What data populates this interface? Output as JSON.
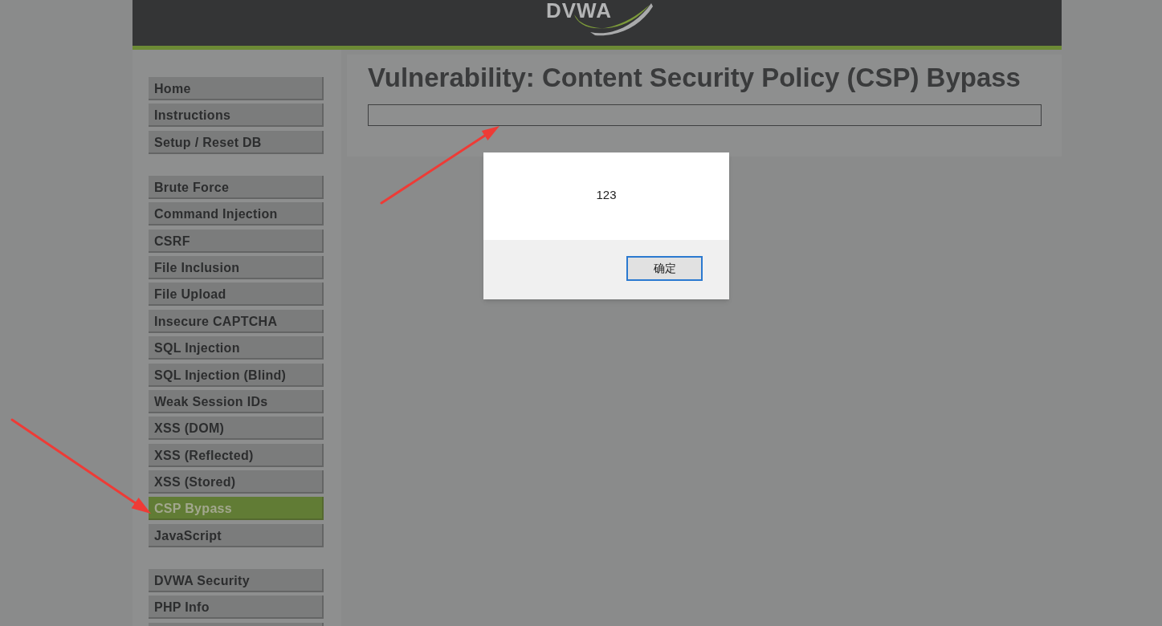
{
  "header": {
    "logo_text": "DVWA"
  },
  "menu": [
    {
      "items": [
        {
          "label": "Home",
          "selected": false
        },
        {
          "label": "Instructions",
          "selected": false
        },
        {
          "label": "Setup / Reset DB",
          "selected": false
        }
      ]
    },
    {
      "items": [
        {
          "label": "Brute Force",
          "selected": false
        },
        {
          "label": "Command Injection",
          "selected": false
        },
        {
          "label": "CSRF",
          "selected": false
        },
        {
          "label": "File Inclusion",
          "selected": false
        },
        {
          "label": "File Upload",
          "selected": false
        },
        {
          "label": "Insecure CAPTCHA",
          "selected": false
        },
        {
          "label": "SQL Injection",
          "selected": false
        },
        {
          "label": "SQL Injection (Blind)",
          "selected": false
        },
        {
          "label": "Weak Session IDs",
          "selected": false
        },
        {
          "label": "XSS (DOM)",
          "selected": false
        },
        {
          "label": "XSS (Reflected)",
          "selected": false
        },
        {
          "label": "XSS (Stored)",
          "selected": false
        },
        {
          "label": "CSP Bypass",
          "selected": true
        },
        {
          "label": "JavaScript",
          "selected": false
        }
      ]
    },
    {
      "items": [
        {
          "label": "DVWA Security",
          "selected": false
        },
        {
          "label": "PHP Info",
          "selected": false
        }
      ],
      "cut_off_item": true
    }
  ],
  "heading": "Vulnerability: Content Security Policy (CSP) Bypass",
  "dialog": {
    "message": "123",
    "button": "确定"
  }
}
